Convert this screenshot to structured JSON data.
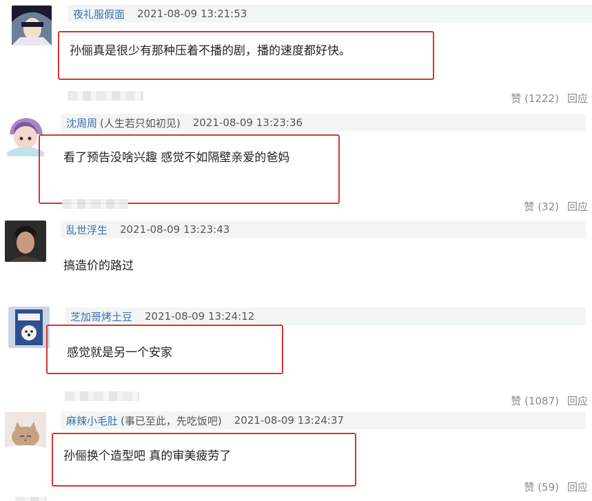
{
  "comments": [
    {
      "username": "夜礼服假面",
      "tag": "",
      "time": "2021-08-09 13:21:53",
      "text": "孙俪真是很少有那种压着不播的剧，播的速度都好快。",
      "like_label": "赞 (1222)",
      "reply_label": "回应",
      "avatar_colors": [
        "#6b7f99",
        "#1a1a2a",
        "#f2e0cc"
      ]
    },
    {
      "username": "沈周周",
      "tag": "(人生若只如初见)",
      "time": "2021-08-09 13:23:36",
      "text": "看了预告没啥兴趣 感觉不如隔壁亲爱的爸妈",
      "like_label": "赞 (32)",
      "reply_label": "回应",
      "avatar_colors": [
        "#bfe3e9",
        "#a988c4",
        "#f4d6cf"
      ]
    },
    {
      "username": "乱世浮生",
      "tag": "",
      "time": "2021-08-09 13:23:43",
      "text": "搞造价的路过",
      "like_label": "",
      "reply_label": "",
      "avatar_colors": [
        "#2b2b2b",
        "#4a3a33",
        "#c89a84"
      ]
    },
    {
      "username": "芝加哥烤土豆",
      "tag": "",
      "time": "2021-08-09 13:24:12",
      "text": "感觉就是另一个安家",
      "like_label": "赞 (1087)",
      "reply_label": "回应",
      "avatar_colors": [
        "#2f4f8f",
        "#f1f1f1",
        "#c9d6e6"
      ]
    },
    {
      "username": "麻辣小毛肚",
      "tag": "(事已至此，先吃饭吧)",
      "time": "2021-08-09 13:24:37",
      "text": "孙俪换个造型吧 真的审美疲劳了",
      "like_label": "赞 (59)",
      "reply_label": "回应",
      "avatar_colors": [
        "#efe6df",
        "#c7a183",
        "#8a6a55"
      ]
    }
  ],
  "colors": {
    "highlight": "#d9342b",
    "username": "#3a6fb0",
    "meta_bg": "#f1f6f4"
  }
}
